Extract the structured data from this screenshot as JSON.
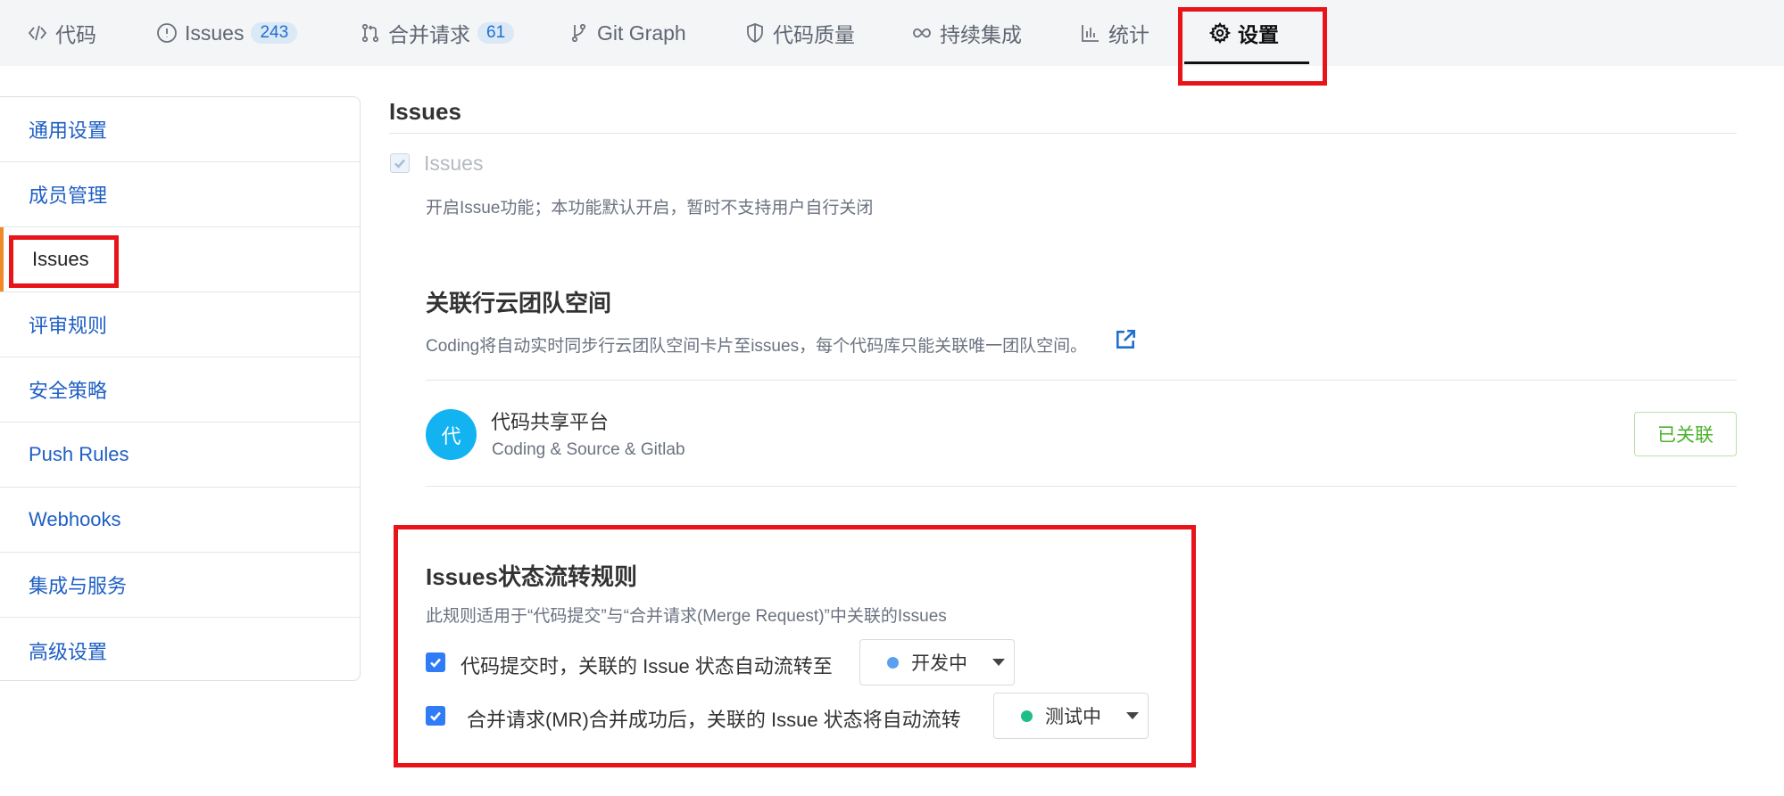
{
  "tabs": [
    {
      "label": "代码",
      "icon": "code-icon"
    },
    {
      "label": "Issues",
      "icon": "alert-circle-icon",
      "count": "243"
    },
    {
      "label": "合并请求",
      "icon": "merge-request-icon",
      "count": "61"
    },
    {
      "label": "Git Graph",
      "icon": "git-branch-icon"
    },
    {
      "label": "代码质量",
      "icon": "shield-icon"
    },
    {
      "label": "持续集成",
      "icon": "infinity-icon"
    },
    {
      "label": "统计",
      "icon": "bar-chart-icon"
    },
    {
      "label": "设置",
      "icon": "gear-icon",
      "active": true
    }
  ],
  "sidebar": {
    "items": [
      {
        "label": "通用设置"
      },
      {
        "label": "成员管理"
      },
      {
        "label": "Issues",
        "active": true
      },
      {
        "label": "评审规则"
      },
      {
        "label": "安全策略"
      },
      {
        "label": "Push Rules"
      },
      {
        "label": "Webhooks"
      },
      {
        "label": "集成与服务"
      },
      {
        "label": "高级设置"
      }
    ]
  },
  "main": {
    "title": "Issues",
    "issues_toggle": {
      "label": "Issues",
      "checked": true,
      "disabled": true,
      "description": "开启Issue功能；本功能默认开启，暂时不支持用户自行关闭"
    },
    "team_space": {
      "title": "关联行云团队空间",
      "description": "Coding将自动实时同步行云团队空间卡片至issues，每个代码库只能关联唯一团队空间。",
      "project": {
        "avatar_text": "代",
        "name": "代码共享平台",
        "subtitle": "Coding & Source & Gitlab",
        "button_label": "已关联"
      }
    },
    "flow_rules": {
      "title": "Issues状态流转规则",
      "description": "此规则适用于“代码提交”与“合并请求(Merge Request)”中关联的Issues",
      "rules": [
        {
          "label": "代码提交时，关联的 Issue 状态自动流转至",
          "checked": true,
          "status": "开发中",
          "status_color": "#5aa0f0"
        },
        {
          "label": "合并请求(MR)合并成功后，关联的 Issue 状态将自动流转",
          "checked": true,
          "status": "测试中",
          "status_color": "#1dbf86"
        }
      ]
    }
  },
  "colors": {
    "accent_blue": "#1f5fc4",
    "highlight_red": "#e8141a",
    "active_bar": "#f08a24"
  }
}
